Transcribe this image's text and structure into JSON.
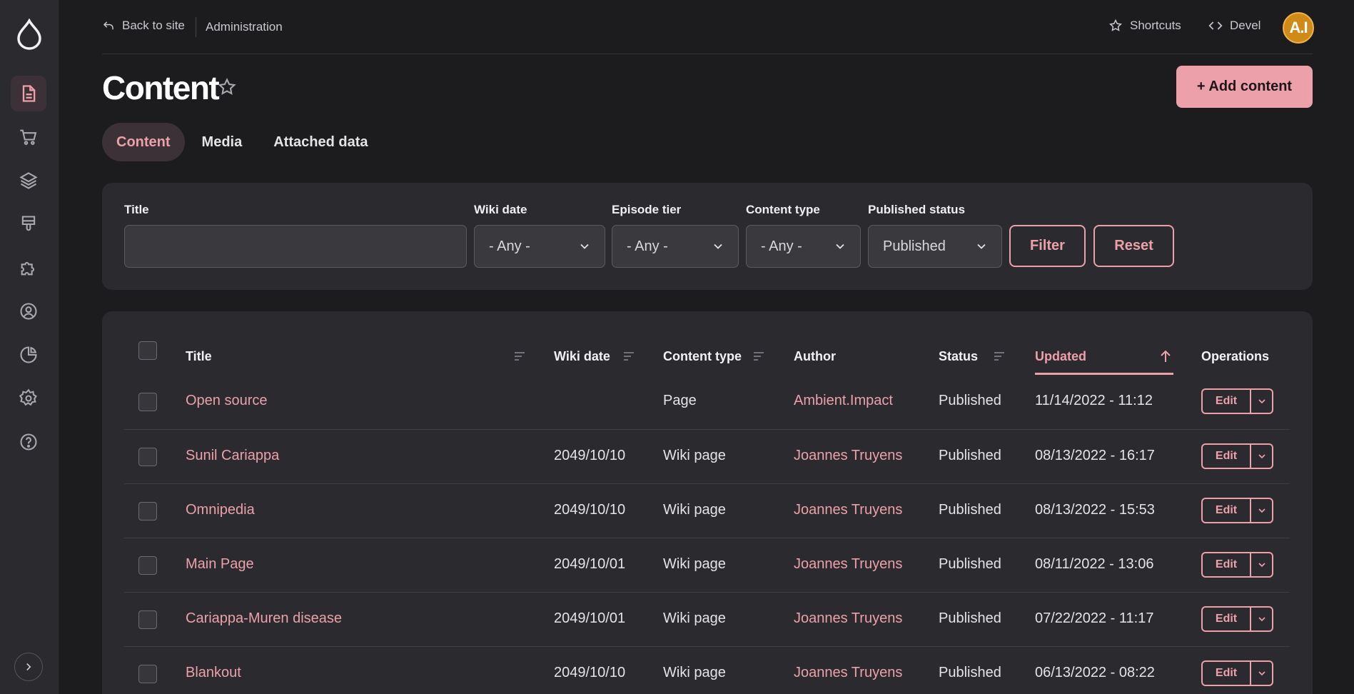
{
  "topbar": {
    "back_label": "Back to site",
    "admin_label": "Administration",
    "shortcuts_label": "Shortcuts",
    "devel_label": "Devel",
    "avatar_initials": "A.I"
  },
  "page": {
    "title": "Content",
    "add_button": "+ Add content"
  },
  "tabs": [
    {
      "label": "Content",
      "active": true
    },
    {
      "label": "Media",
      "active": false
    },
    {
      "label": "Attached data",
      "active": false
    }
  ],
  "filters": {
    "title_label": "Title",
    "title_value": "",
    "wiki_date_label": "Wiki date",
    "wiki_date_value": "- Any -",
    "episode_tier_label": "Episode tier",
    "episode_tier_value": "- Any -",
    "content_type_label": "Content type",
    "content_type_value": "- Any -",
    "published_status_label": "Published status",
    "published_status_value": "Published",
    "filter_button": "Filter",
    "reset_button": "Reset"
  },
  "table": {
    "headers": {
      "title": "Title",
      "wiki_date": "Wiki date",
      "content_type": "Content type",
      "author": "Author",
      "status": "Status",
      "updated": "Updated",
      "operations": "Operations"
    },
    "edit_label": "Edit",
    "rows": [
      {
        "title": "Open source",
        "wiki_date": "",
        "type": "Page",
        "author": "Ambient.Impact",
        "status": "Published",
        "updated": "11/14/2022 - 11:12"
      },
      {
        "title": "Sunil Cariappa",
        "wiki_date": "2049/10/10",
        "type": "Wiki page",
        "author": "Joannes Truyens",
        "status": "Published",
        "updated": "08/13/2022 - 16:17"
      },
      {
        "title": "Omnipedia",
        "wiki_date": "2049/10/10",
        "type": "Wiki page",
        "author": "Joannes Truyens",
        "status": "Published",
        "updated": "08/13/2022 - 15:53"
      },
      {
        "title": "Main Page",
        "wiki_date": "2049/10/01",
        "type": "Wiki page",
        "author": "Joannes Truyens",
        "status": "Published",
        "updated": "08/11/2022 - 13:06"
      },
      {
        "title": "Cariappa-Muren disease",
        "wiki_date": "2049/10/01",
        "type": "Wiki page",
        "author": "Joannes Truyens",
        "status": "Published",
        "updated": "07/22/2022 - 11:17"
      },
      {
        "title": "Blankout",
        "wiki_date": "2049/10/10",
        "type": "Wiki page",
        "author": "Joannes Truyens",
        "status": "Published",
        "updated": "06/13/2022 - 08:22"
      }
    ]
  },
  "colors": {
    "accent": "#eba0aa",
    "background": "#1c1c1f",
    "panel": "#2b2b2f",
    "sidebar": "#2b2b2f"
  },
  "sidebar": {
    "items": [
      "content-icon",
      "cart-icon",
      "layers-icon",
      "brush-icon",
      "puzzle-icon",
      "user-icon",
      "chart-pie-icon",
      "gear-icon",
      "help-icon"
    ]
  }
}
